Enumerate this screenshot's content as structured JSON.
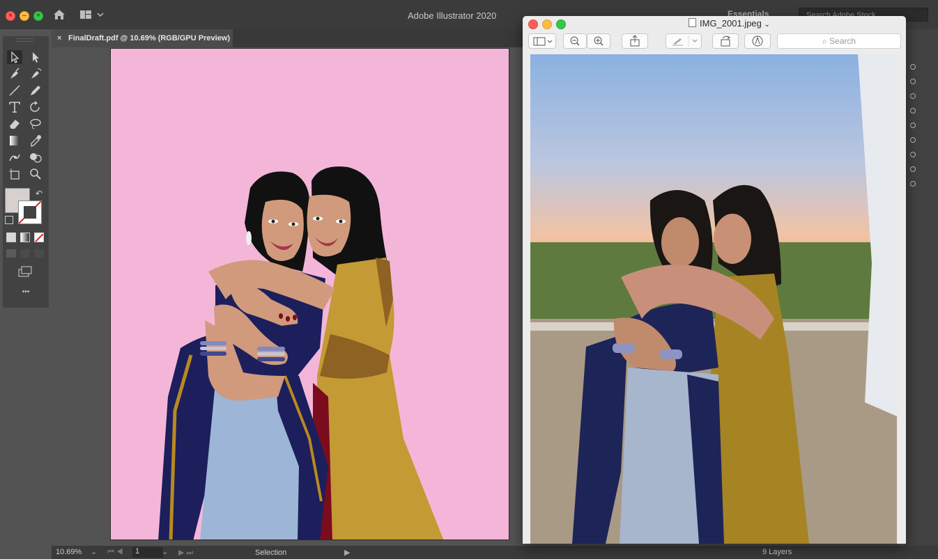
{
  "illustrator": {
    "window_title": "Adobe Illustrator 2020",
    "workspace_label": "Essentials",
    "stock_search_placeholder": "Search Adobe Stock",
    "document_tab_close": "×",
    "document_tab_label": "FinalDraft.pdf @ 10.69% (RGB/GPU Preview)",
    "more_tools_label": "•••",
    "artboard_color": "#f4b6d8",
    "status": {
      "zoom": "10.69%",
      "artboard_number": "1",
      "mode": "Selection",
      "layers_count": "9 Layers"
    },
    "tools": [
      "selection-tool",
      "direct-selection-tool",
      "pen-tool",
      "curvature-tool",
      "line-tool",
      "pencil-tool",
      "type-tool",
      "rotate-tool",
      "eraser-tool",
      "lasso-tool",
      "gradient-tool",
      "eyedropper-tool",
      "puppet-warp-tool",
      "shape-builder-tool",
      "artboard-tool",
      "zoom-tool"
    ],
    "fill_color": "#d8cfcf",
    "stroke_color": "none"
  },
  "preview": {
    "title": "IMG_2001.jpeg",
    "search_placeholder": "Search",
    "toolbar": [
      "sidebar-toggle",
      "zoom-out",
      "zoom-in",
      "share",
      "markup-highlight",
      "rotate",
      "annotate"
    ]
  },
  "colors": {
    "navy_dupatta": "#1c1f5c",
    "gold_trim": "#b88a1f",
    "mustard_dress": "#c39a34",
    "mustard_dark": "#8d6222",
    "skirt_blue": "#9db5d6",
    "skin": "#d19a7c",
    "hair": "#111111",
    "maroon": "#7a0c1e"
  }
}
